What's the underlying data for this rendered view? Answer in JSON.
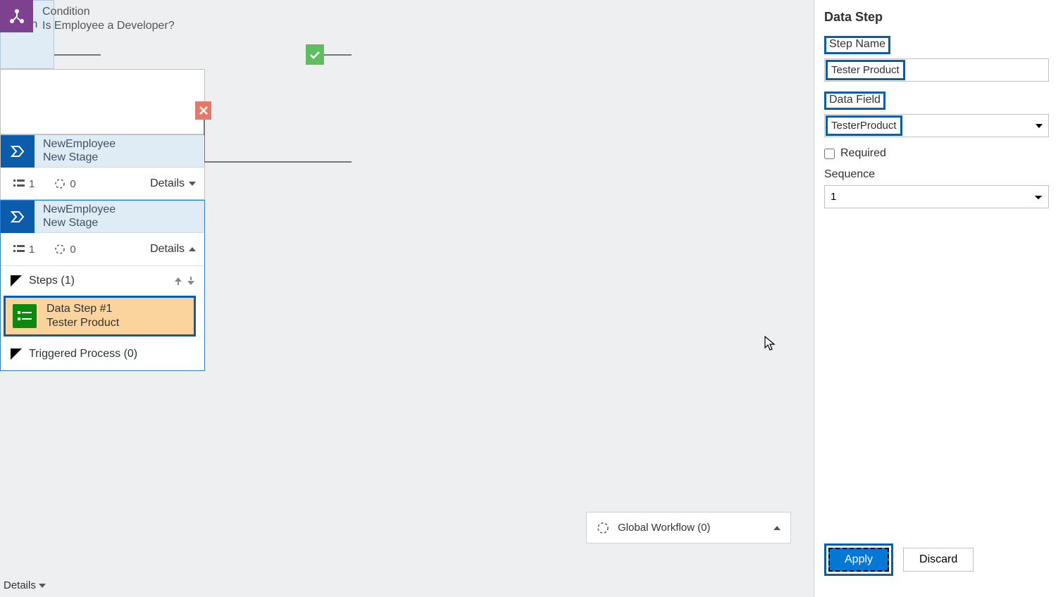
{
  "canvas": {
    "partialNode": {
      "label": "osition",
      "details": "Details"
    },
    "condition": {
      "typeLabel": "Condition",
      "question": "Is Employee a Developer?"
    },
    "stage1": {
      "entity": "NewEmployee",
      "name": "New Stage",
      "count1": "1",
      "count2": "0",
      "details": "Details"
    },
    "stage2": {
      "entity": "NewEmployee",
      "name": "New Stage",
      "count1": "1",
      "count2": "0",
      "details": "Details",
      "stepsHeader": "Steps (1)",
      "dataStep": {
        "title": "Data Step #1",
        "field": "Tester Product"
      },
      "triggered": "Triggered Process (0)"
    }
  },
  "globalWorkflow": {
    "label": "Global Workflow (0)"
  },
  "panel": {
    "title": "Data Step",
    "stepNameLabel": "Step Name",
    "stepNameValue": "Tester Product",
    "dataFieldLabel": "Data Field",
    "dataFieldValue": "TesterProduct",
    "requiredLabel": "Required",
    "sequenceLabel": "Sequence",
    "sequenceValue": "1",
    "applyLabel": "Apply",
    "discardLabel": "Discard"
  }
}
